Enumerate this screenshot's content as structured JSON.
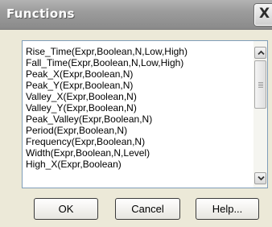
{
  "window": {
    "title": "Functions",
    "close_icon": "close-icon",
    "close_glyph": "X"
  },
  "list": {
    "items": [
      "Rise_Time(Expr,Boolean,N,Low,High)",
      "Fall_Time(Expr,Boolean,N,Low,High)",
      "Peak_X(Expr,Boolean,N)",
      "Peak_Y(Expr,Boolean,N)",
      "Valley_X(Expr,Boolean,N)",
      "Valley_Y(Expr,Boolean,N)",
      "Peak_Valley(Expr,Boolean,N)",
      "Period(Expr,Boolean,N)",
      "Frequency(Expr,Boolean,N)",
      "Width(Expr,Boolean,N,Level)",
      "High_X(Expr,Boolean)"
    ]
  },
  "scrollbar": {
    "up_icon": "scroll-up-arrow-icon",
    "down_icon": "scroll-down-arrow-icon"
  },
  "buttons": {
    "ok": "OK",
    "cancel": "Cancel",
    "help": "Help..."
  }
}
